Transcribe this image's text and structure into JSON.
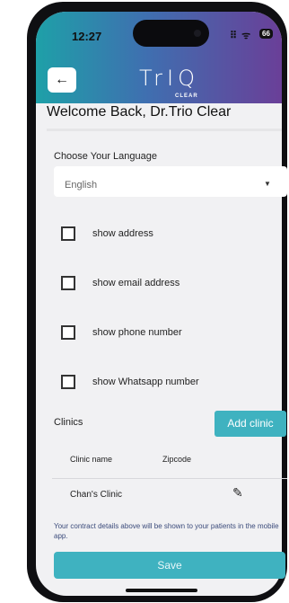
{
  "status_bar": {
    "time": "12:27",
    "signal": "∷ • ≡",
    "battery": "66"
  },
  "header": {
    "back_icon": "←",
    "logo_main": "TrIQ",
    "logo_sub": "CLEAR"
  },
  "welcome": {
    "text": "Welcome Back, Dr.Trio Clear"
  },
  "language": {
    "label": "Choose Your Language",
    "selected": "English",
    "arrow": "▼"
  },
  "options": [
    {
      "label": "show address"
    },
    {
      "label": "show email address"
    },
    {
      "label": "show phone number"
    },
    {
      "label": "show Whatsapp number"
    }
  ],
  "clinics": {
    "title": "Clinics",
    "add_label": "Add clinic",
    "columns": [
      "Clinic name",
      "Zipcode"
    ],
    "rows": [
      {
        "name": "Chan's Clinic",
        "edit_icon": "✎"
      }
    ]
  },
  "note": "Your contract details above will be shown to your patients in the mobile app.",
  "save_label": "Save",
  "colors": {
    "accent": "#3fb2c0",
    "header_start": "#1ea0a8",
    "header_end": "#6a3f98"
  }
}
